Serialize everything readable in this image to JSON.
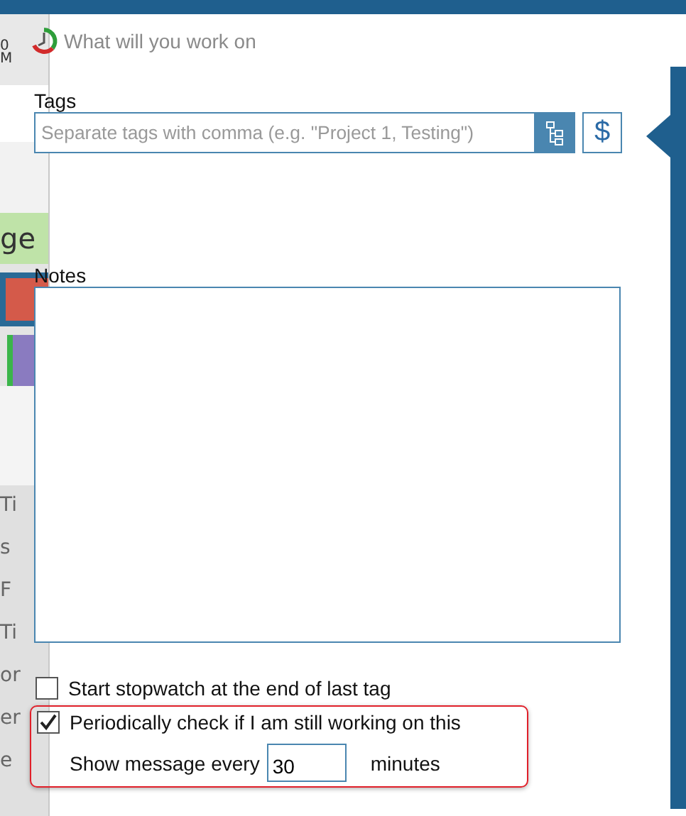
{
  "background_app": {
    "fragments": [
      {
        "text": "0",
        "kind": "time"
      },
      {
        "text": "M",
        "kind": "time"
      },
      {
        "text": "ge",
        "kind": "tile-green"
      },
      {
        "text": "Ti",
        "kind": "row"
      },
      {
        "text": "s",
        "kind": "row"
      },
      {
        "text": "F",
        "kind": "row"
      },
      {
        "text": "Ti",
        "kind": "row"
      },
      {
        "text": "or",
        "kind": "row"
      },
      {
        "text": "er",
        "kind": "row"
      },
      {
        "text": "e",
        "kind": "row"
      }
    ]
  },
  "dialog": {
    "title": "What will you work on",
    "tags": {
      "label": "Tags",
      "placeholder": "Separate tags with comma (e.g. \"Project 1, Testing\")",
      "currency_button": "$"
    },
    "notes": {
      "label": "Notes"
    },
    "options": [
      {
        "label": "Start stopwatch at the end of last tag",
        "checked": false,
        "highlighted": false
      },
      {
        "label": "Periodically check if I am still working on this",
        "checked": true,
        "highlighted": true
      }
    ],
    "interval": {
      "prefix": "Show message every",
      "value": "30",
      "suffix": "minutes"
    }
  }
}
